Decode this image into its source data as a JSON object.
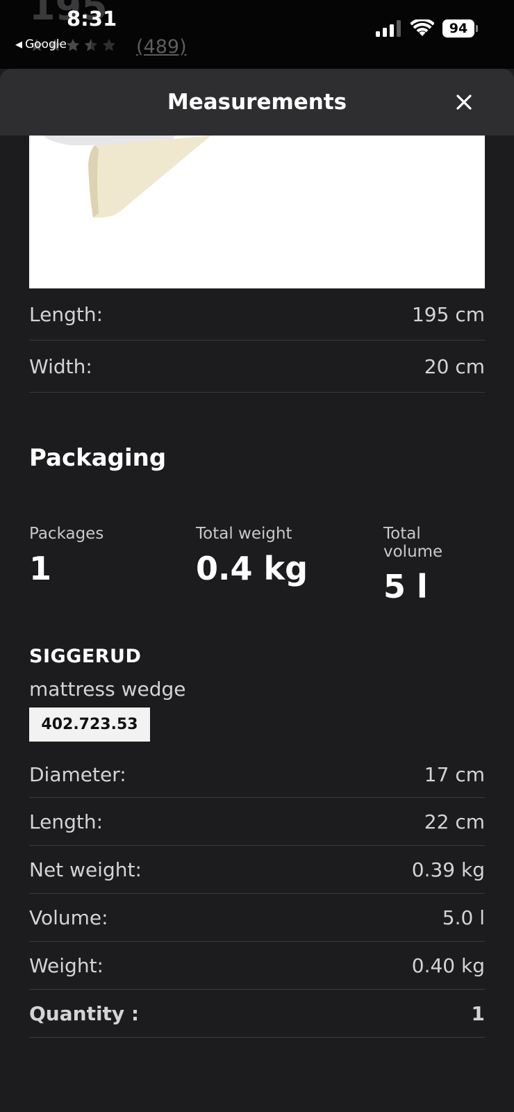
{
  "status_bar": {
    "time": "8:31",
    "back_label": "Google",
    "battery": "94"
  },
  "background_page": {
    "price_fragment": "195",
    "rating": 3.5,
    "review_count": "(489)"
  },
  "sheet": {
    "title": "Measurements",
    "close_icon": "close-icon"
  },
  "dimensions": [
    {
      "label": "Length:",
      "value": "195 cm"
    },
    {
      "label": "Width:",
      "value": "20 cm"
    }
  ],
  "packaging": {
    "title": "Packaging",
    "stats": [
      {
        "label": "Packages",
        "value": "1"
      },
      {
        "label": "Total weight",
        "value": "0.4 kg"
      },
      {
        "label": "Total volume",
        "value": "5 l"
      }
    ],
    "product_name": "SIGGERUD",
    "product_type": "mattress wedge",
    "article_number": "402.723.53",
    "specs": [
      {
        "label": "Diameter:",
        "value": "17 cm"
      },
      {
        "label": "Length:",
        "value": "22 cm"
      },
      {
        "label": "Net weight:",
        "value": "0.39 kg"
      },
      {
        "label": "Volume:",
        "value": "5.0 l"
      },
      {
        "label": "Weight:",
        "value": "0.40 kg"
      },
      {
        "label": "Quantity :",
        "value": "1"
      }
    ]
  }
}
